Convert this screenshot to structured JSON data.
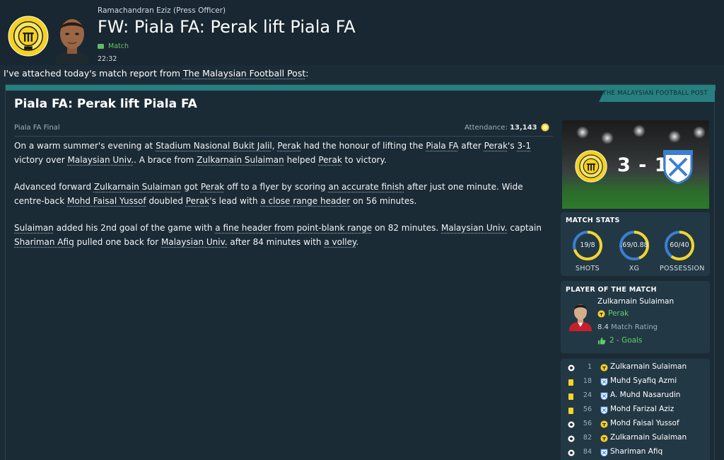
{
  "header": {
    "sender": "Ramachandran Eziz  (Press Officer)",
    "subject": "FW: Piala FA: Perak lift Piala FA",
    "tag": "Match",
    "time": "22:32"
  },
  "intro": {
    "before": "I've attached today's match report from ",
    "link": "The Malaysian Football Post",
    "after": ":"
  },
  "article": {
    "source": "THE MALAYSIAN FOOTBALL POST",
    "title": "Piala FA: Perak lift Piala FA",
    "competition": "Piala FA Final",
    "attendance_label": "Attendance:",
    "attendance_value": "13,143",
    "paragraphs": [
      [
        {
          "t": "On a warm summer's evening at "
        },
        {
          "t": "Stadium Nasional Bukit Jalil",
          "link": true
        },
        {
          "t": ", "
        },
        {
          "t": "Perak",
          "link": true
        },
        {
          "t": " had the honour of lifting the "
        },
        {
          "t": "Piala FA",
          "link": true
        },
        {
          "t": " after "
        },
        {
          "t": "Perak",
          "link": true
        },
        {
          "t": "'s "
        },
        {
          "t": "3-1",
          "link": true
        },
        {
          "t": " victory over "
        },
        {
          "t": "Malaysian Univ.",
          "link": true
        },
        {
          "t": ". A brace from "
        },
        {
          "t": "Zulkarnain Sulaiman",
          "link": true
        },
        {
          "t": " helped "
        },
        {
          "t": "Perak",
          "link": true
        },
        {
          "t": " to victory."
        }
      ],
      [
        {
          "t": "Advanced forward "
        },
        {
          "t": "Zulkarnain Sulaiman",
          "link": true
        },
        {
          "t": " got "
        },
        {
          "t": "Perak",
          "link": true
        },
        {
          "t": " off to a flyer by scoring "
        },
        {
          "t": "an accurate finish",
          "link": true
        },
        {
          "t": " after just one minute. Wide centre-back "
        },
        {
          "t": "Mohd Faisal Yussof",
          "link": true
        },
        {
          "t": " doubled "
        },
        {
          "t": "Perak",
          "link": true
        },
        {
          "t": "'s lead with "
        },
        {
          "t": "a close range header",
          "link": true
        },
        {
          "t": " on 56 minutes."
        }
      ],
      [
        {
          "t": "Sulaiman",
          "link": true
        },
        {
          "t": " added his 2nd goal of the game with "
        },
        {
          "t": "a fine header from point-blank range",
          "link": true
        },
        {
          "t": " on 82 minutes. "
        },
        {
          "t": "Malaysian Univ.",
          "link": true
        },
        {
          "t": " captain "
        },
        {
          "t": "Shariman Afiq",
          "link": true
        },
        {
          "t": " pulled one back for "
        },
        {
          "t": "Malaysian Univ.",
          "link": true
        },
        {
          "t": " after 84 minutes with "
        },
        {
          "t": "a volley",
          "link": true
        },
        {
          "t": "."
        }
      ]
    ]
  },
  "scoreboard": {
    "score": "3 - 1",
    "home_team": "Perak",
    "away_team": "Malaysian Univ."
  },
  "match_stats": {
    "title": "MATCH STATS",
    "items": [
      {
        "label": "SHOTS",
        "value": "19/8",
        "home_share": 0.7
      },
      {
        "label": "XG",
        "value": ".69/0.88",
        "home_share": 0.44
      },
      {
        "label": "POSSESSION",
        "value": "60/40",
        "home_share": 0.6
      }
    ]
  },
  "potm": {
    "title": "PLAYER OF THE MATCH",
    "name": "Zulkarnain Sulaiman",
    "club": "Perak",
    "rating": "8.4",
    "rating_label": "Match Rating",
    "goals": "2 - Goals"
  },
  "events": [
    {
      "type": "goal",
      "minute": "1",
      "team": "home",
      "player": "Zulkarnain Sulaiman"
    },
    {
      "type": "yellow",
      "minute": "18",
      "team": "away",
      "player": "Muhd Syafiq Azmi"
    },
    {
      "type": "yellow",
      "minute": "24",
      "team": "away",
      "player": "A. Muhd Nasarudin"
    },
    {
      "type": "yellow",
      "minute": "56",
      "team": "away",
      "player": "Mohd Farizal Aziz"
    },
    {
      "type": "goal",
      "minute": "56",
      "team": "home",
      "player": "Mohd Faisal Yussof"
    },
    {
      "type": "goal",
      "minute": "82",
      "team": "home",
      "player": "Zulkarnain Sulaiman"
    },
    {
      "type": "goal",
      "minute": "84",
      "team": "away",
      "player": "Shariman Afiq"
    }
  ],
  "colors": {
    "accent": "#27807f",
    "home": "#f2d52a",
    "away": "#3b7fd0",
    "positive": "#5fd06a"
  }
}
